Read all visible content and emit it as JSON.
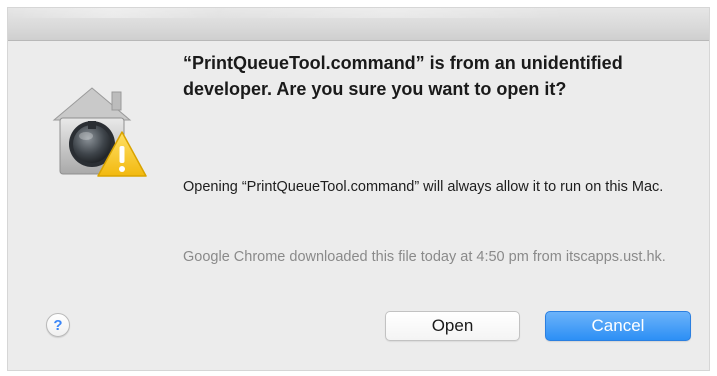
{
  "dialog": {
    "headline": "“PrintQueueTool.command” is from an unidentified developer. Are you sure you want to open it?",
    "body": "Opening “PrintQueueTool.command” will always allow it to run on this Mac.",
    "secondary": "Google Chrome downloaded this file today at 4:50 pm from itscapps.ust.hk.",
    "icon": "gatekeeper-warning-icon",
    "help_label": "?",
    "buttons": {
      "open_label": "Open",
      "cancel_label": "Cancel"
    }
  },
  "colors": {
    "dialog_bg": "#ececec",
    "accent": "#2c8ff5",
    "secondary_text": "#8a8a8a",
    "warning": "#f5c518"
  }
}
